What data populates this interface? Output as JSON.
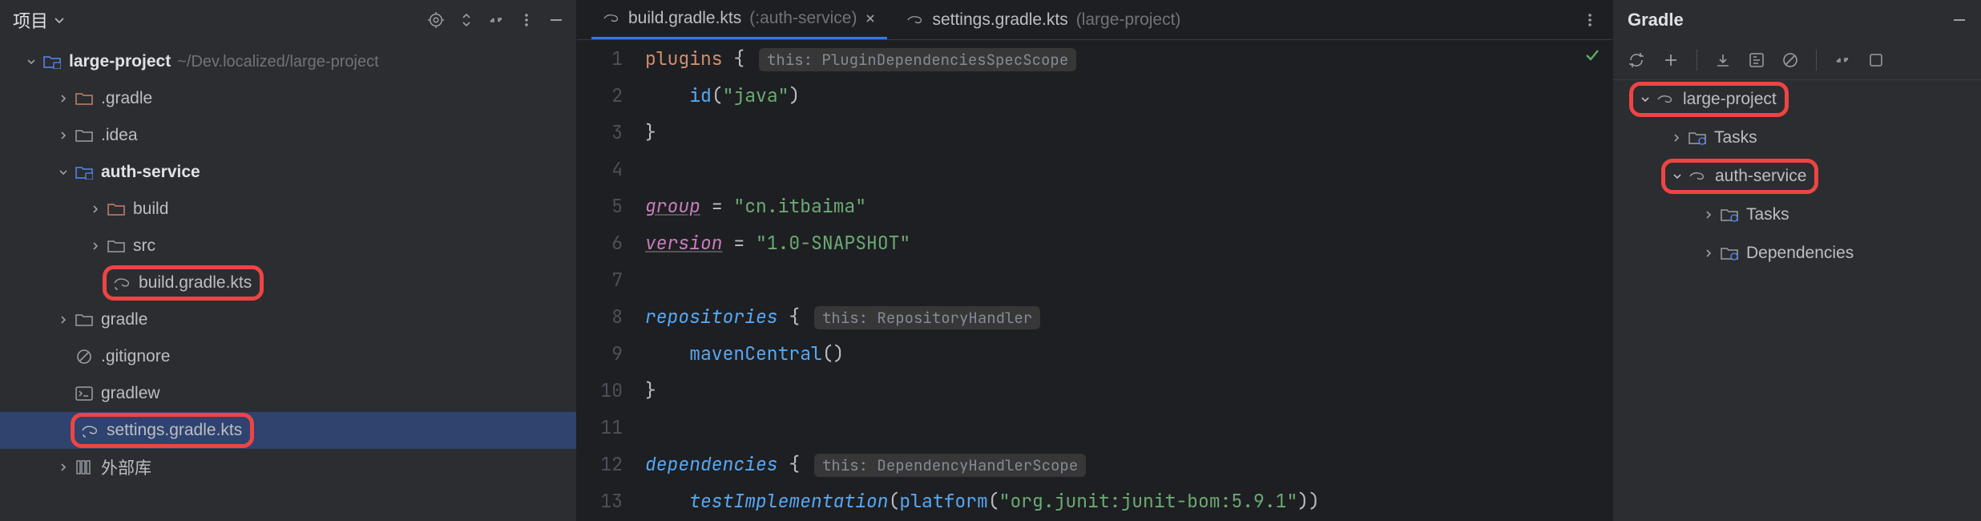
{
  "project_panel": {
    "title": "项目",
    "root": {
      "name": "large-project",
      "path": "~/Dev.localized/large-project"
    },
    "nodes": {
      "gradle_dir": ".gradle",
      "idea_dir": ".idea",
      "auth_service": "auth-service",
      "build": "build",
      "src": "src",
      "build_kts": "build.gradle.kts",
      "gradle_folder": "gradle",
      "gitignore": ".gitignore",
      "gradlew": "gradlew",
      "settings_kts": "settings.gradle.kts",
      "external_libs": "外部库"
    }
  },
  "tabs": {
    "active": {
      "name": "build.gradle.kts",
      "context": "(:auth-service)"
    },
    "other": {
      "name": "settings.gradle.kts",
      "context": "(large-project)"
    }
  },
  "code": {
    "l1a": "plugins",
    "l1b": " {",
    "hint1": "this: PluginDependenciesSpecScope",
    "l2a": "    id",
    "l2b": "(",
    "l2c": "\"java\"",
    "l2d": ")",
    "l3": "}",
    "l5a": "group",
    "l5b": " = ",
    "l5c": "\"cn.itbaima\"",
    "l6a": "version",
    "l6b": " = ",
    "l6c": "\"1.0-SNAPSHOT\"",
    "l8a": "repositories",
    "l8b": " {",
    "hint8": "this: RepositoryHandler",
    "l9a": "    mavenCentral",
    "l9b": "()",
    "l10": "}",
    "l12a": "dependencies",
    "l12b": " {",
    "hint12": "this: DependencyHandlerScope",
    "l13a": "    testImplementation",
    "l13b": "(",
    "l13c": "platform",
    "l13d": "(",
    "l13e": "\"org.junit:junit-bom:5.9.1\"",
    "l13f": "))"
  },
  "gutter": [
    "1",
    "2",
    "3",
    "4",
    "5",
    "6",
    "7",
    "8",
    "9",
    "10",
    "11",
    "12",
    "13"
  ],
  "gradle": {
    "title": "Gradle",
    "root": "large-project",
    "tasks": "Tasks",
    "sub": "auth-service",
    "subtasks": "Tasks",
    "deps": "Dependencies"
  }
}
